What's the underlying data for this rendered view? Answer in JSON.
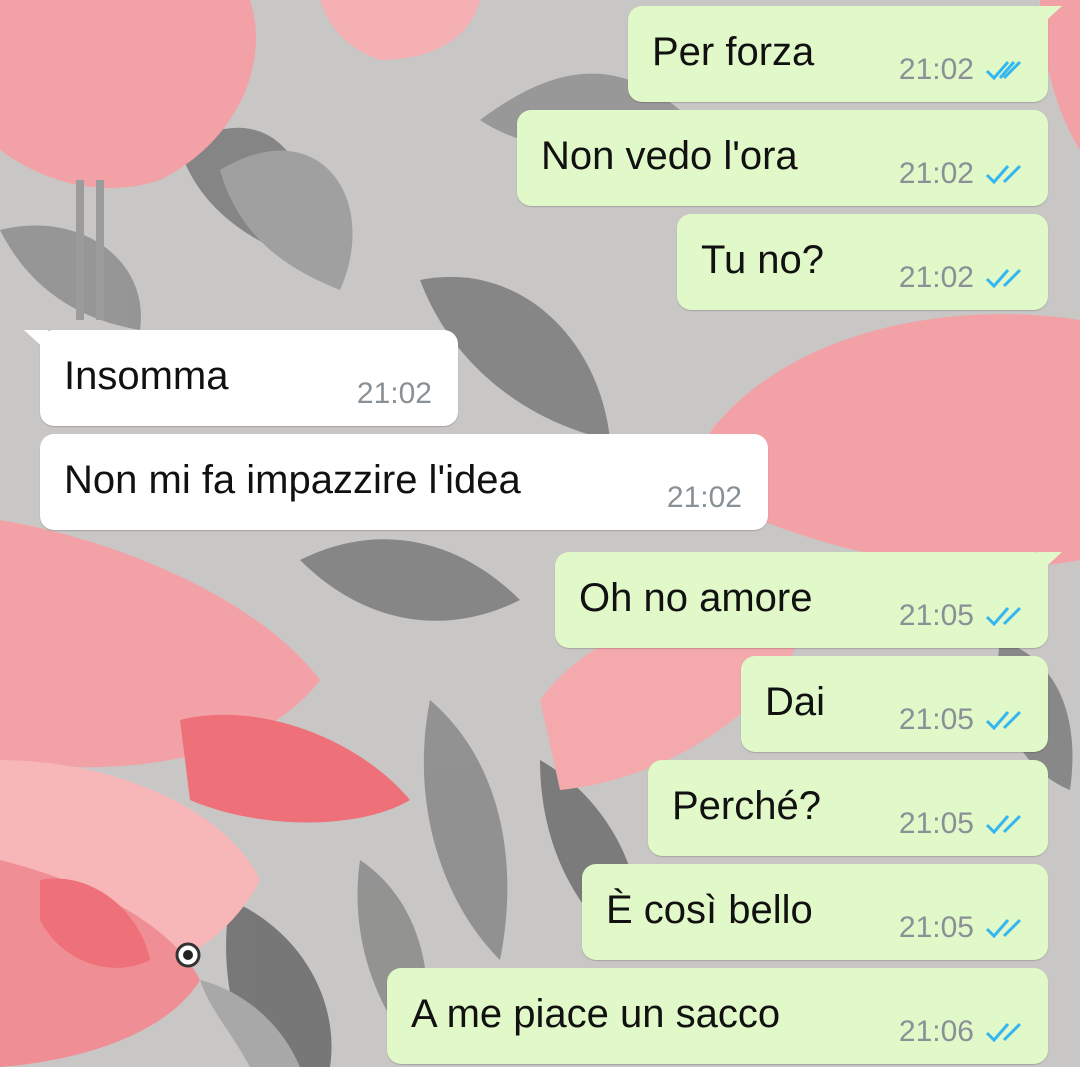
{
  "colors": {
    "outgoing_bubble": "#e1f8c8",
    "incoming_bubble": "#ffffff",
    "timestamp": "#8a9196",
    "read_ticks": "#34b7f1",
    "wallpaper_flamingo": "#f2a1a6",
    "wallpaper_leaves": "#6b6b6b"
  },
  "wallpaper": {
    "theme": "flamingos-and-tropical-leaves"
  },
  "messages": [
    {
      "direction": "outgoing",
      "text": "Per forza",
      "time": "21:02",
      "status": "read"
    },
    {
      "direction": "outgoing",
      "text": "Non vedo l'ora",
      "time": "21:02",
      "status": "read"
    },
    {
      "direction": "outgoing",
      "text": "Tu no?",
      "time": "21:02",
      "status": "read"
    },
    {
      "direction": "incoming",
      "text": "Insomma",
      "time": "21:02"
    },
    {
      "direction": "incoming",
      "text": "Non mi fa impazzire l'idea",
      "time": "21:02"
    },
    {
      "direction": "outgoing",
      "text": "Oh no amore",
      "time": "21:05",
      "status": "read"
    },
    {
      "direction": "outgoing",
      "text": "Dai",
      "time": "21:05",
      "status": "read"
    },
    {
      "direction": "outgoing",
      "text": "Perché?",
      "time": "21:05",
      "status": "read"
    },
    {
      "direction": "outgoing",
      "text": "È così bello",
      "time": "21:05",
      "status": "read"
    },
    {
      "direction": "outgoing",
      "text": "A me piace un sacco",
      "time": "21:06",
      "status": "read"
    }
  ]
}
